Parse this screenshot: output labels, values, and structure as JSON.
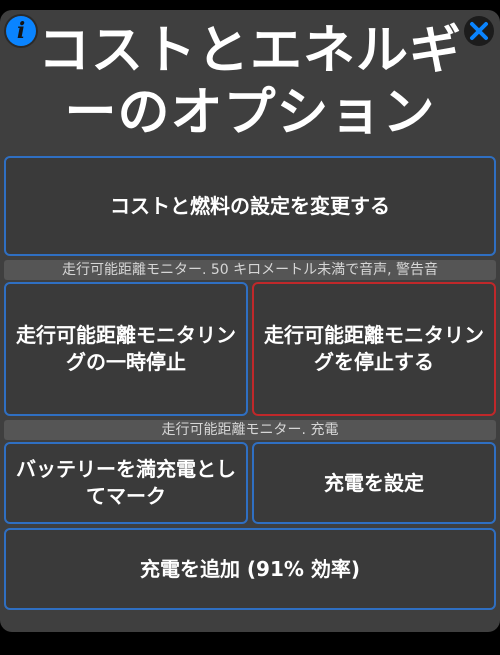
{
  "header": {
    "info_icon_glyph": "i",
    "title_line1": "コストとエネルギ",
    "title_line2": "ーのオプション"
  },
  "buttons": {
    "change_cost_fuel": "コストと燃料の設定を変更する",
    "pause_range_monitoring": "走行可能距離モニタリングの一時停止",
    "stop_range_monitoring": "走行可能距離モニタリングを停止する",
    "mark_fully_charged": "バッテリーを満充電としてマーク",
    "set_charge": "充電を設定",
    "add_charge": "充電を追加 (91% 効率)"
  },
  "sections": {
    "range_monitor_warning": "走行可能距離モニター. 50 キロメートル未満で音声, 警告音",
    "range_monitor_charging": "走行可能距離モニター. 充電"
  },
  "colors": {
    "accent_blue": "#2f6fc2",
    "alert_red": "#c0282a",
    "info_blue": "#0a84ff"
  }
}
